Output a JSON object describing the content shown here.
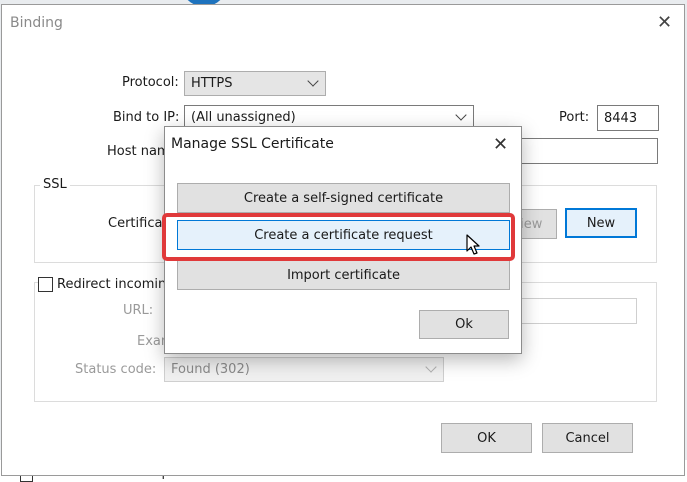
{
  "background": {
    "footer_checkbox_label": "Remove Server response header"
  },
  "binding_dialog": {
    "title": "Binding",
    "protocol": {
      "label": "Protocol:",
      "value": "HTTPS"
    },
    "bind_ip": {
      "label": "Bind to IP:",
      "value": "(All unassigned)"
    },
    "port": {
      "label": "Port:",
      "value": "8443"
    },
    "host_name": {
      "label": "Host name:",
      "value": ""
    },
    "ssl_group": {
      "legend": "SSL",
      "certificate_label": "Certificate:",
      "view_label": "View",
      "new_label": "New"
    },
    "redirect": {
      "checkbox_label": "Redirect incoming",
      "url_label": "URL:",
      "example_label": "Example:",
      "status_code_label": "Status code:",
      "status_code_value": "Found (302)"
    },
    "ok_label": "OK",
    "cancel_label": "Cancel"
  },
  "manage_ssl": {
    "title": "Manage SSL Certificate",
    "buttons": [
      {
        "label": "Create a self-signed certificate"
      },
      {
        "label": "Create a certificate request"
      },
      {
        "label": "Import certificate"
      }
    ],
    "ok_label": "Ok"
  },
  "colors": {
    "highlight": "#e0393a",
    "focus": "#0078d7"
  },
  "icons": {
    "close": "close-icon",
    "dropdown": "chevron-down-icon",
    "cursor": "mouse-pointer-icon"
  }
}
